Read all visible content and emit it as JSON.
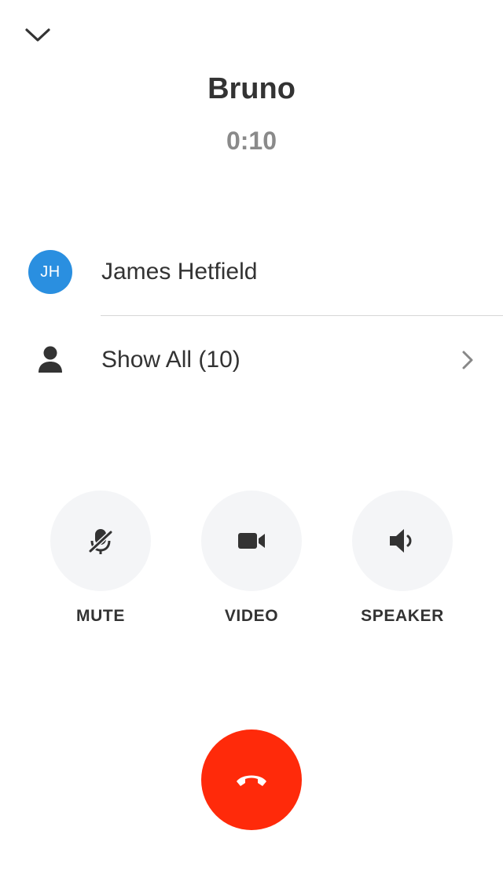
{
  "header": {
    "collapse_icon": "chevron-down-icon",
    "caller_name": "Bruno",
    "duration": "0:10"
  },
  "participants": [
    {
      "initials": "JH",
      "name": "James Hetfield",
      "avatar_color": "#2a8fe0"
    }
  ],
  "show_all": {
    "icon": "person-icon",
    "label": "Show All (10)",
    "chevron_icon": "chevron-right-icon"
  },
  "controls": {
    "mute": {
      "label": "MUTE",
      "icon": "microphone-muted-icon"
    },
    "video": {
      "label": "VIDEO",
      "icon": "video-camera-icon"
    },
    "speaker": {
      "label": "SPEAKER",
      "icon": "speaker-icon"
    }
  },
  "end_call": {
    "icon": "phone-hangup-icon",
    "color": "#ff2a0a"
  },
  "colors": {
    "background": "#ffffff",
    "control_background": "#f4f5f7",
    "text": "#333333",
    "secondary_text": "#8a8a8a"
  }
}
